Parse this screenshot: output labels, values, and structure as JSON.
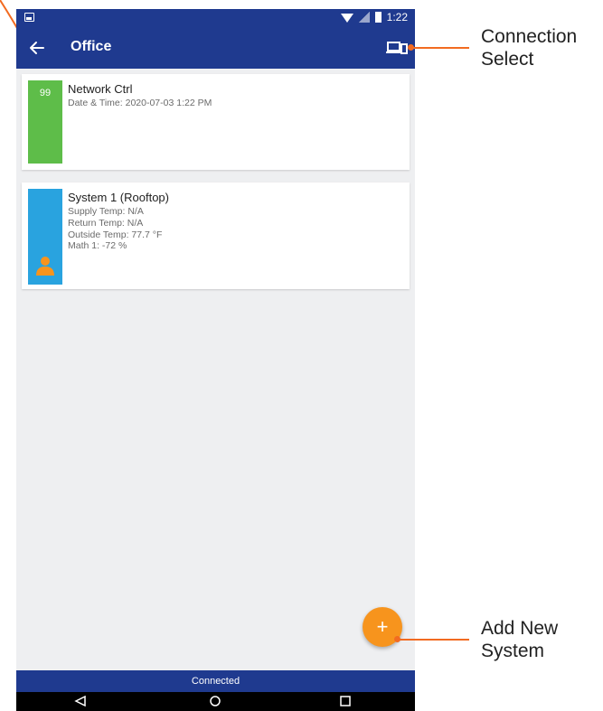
{
  "status_bar": {
    "time": "1:22"
  },
  "app_bar": {
    "title": "Office"
  },
  "systems": [
    {
      "badge": "99",
      "title": "Network Ctrl",
      "lines": [
        "Date & Time: 2020-07-03 1:22 PM"
      ],
      "color": "#5ebd49"
    },
    {
      "badge": "",
      "title": "System 1 (Rooftop)",
      "lines": [
        "Supply Temp: N/A",
        "Return Temp: N/A",
        "Outside Temp: 77.7 °F",
        "Math 1: -72 %"
      ],
      "color": "#29a3df"
    }
  ],
  "fab": {
    "label": "+"
  },
  "connection_bar": {
    "text": "Connected"
  },
  "annotations": {
    "connection_select": [
      "Connection",
      "Select"
    ],
    "add_new_system": [
      "Add New",
      "System"
    ]
  },
  "colors": {
    "appbar": "#1f3a8f",
    "accent": "#f7941d",
    "leader": "#f26b21"
  },
  "icons": {
    "back": "arrow-left-icon",
    "connection": "device-connection-icon",
    "person": "person-icon"
  }
}
